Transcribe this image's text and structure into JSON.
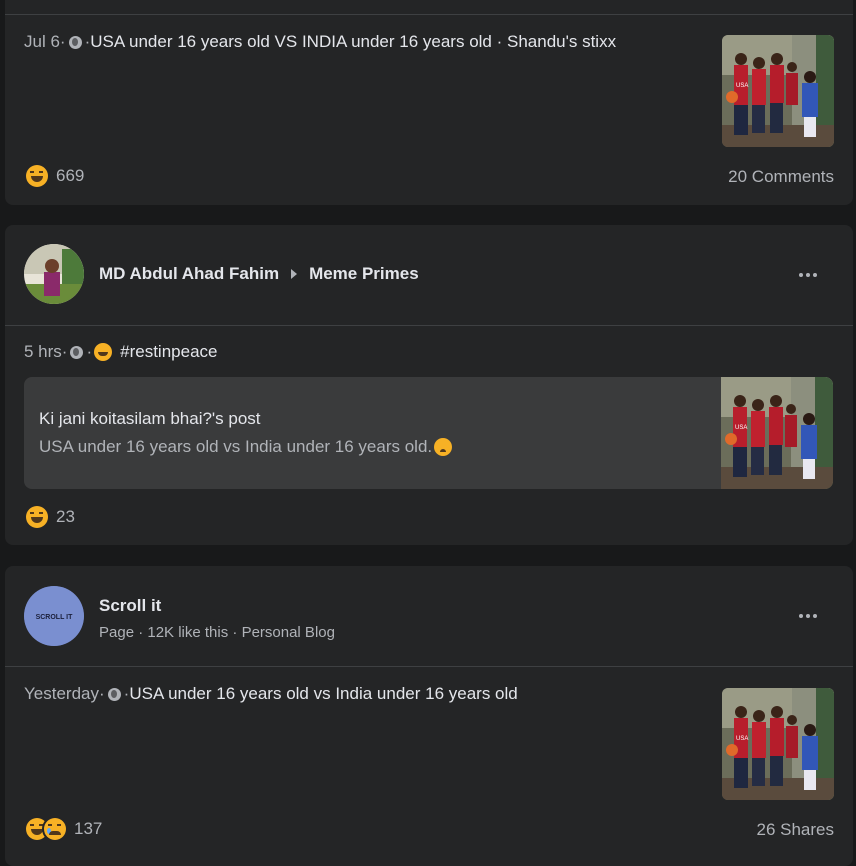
{
  "posts": [
    {
      "time": "Jul 6",
      "sep1": " · ",
      "sep2": " · ",
      "text": "USA under 16 years old VS INDIA under 16 years old · Shandu's stixx",
      "reaction_count": "669",
      "stat_right": "20 Comments"
    },
    {
      "author": "MD Abdul Ahad Fahim",
      "group": "Meme Primes",
      "time": "5 hrs",
      "sep1": " · ",
      "sep2": " · ",
      "hashtag": "#restinpeace",
      "shared_title": "Ki jani koitasilam bhai?'s post",
      "shared_text": "USA under 16 years old vs India under 16 years old.",
      "reaction_count": "23"
    },
    {
      "author": "Scroll it",
      "subtitle": "Page · 12K like this · Personal Blog",
      "avatar_text": "SCROLL IT",
      "time": "Yesterday",
      "sep1": " · ",
      "sep2": " · ",
      "text": "USA under 16 years old vs India under 16 years old",
      "reaction_count": "137",
      "stat_right": "26 Shares"
    }
  ],
  "colors": {
    "background": "#18191a",
    "card": "#242526",
    "text_primary": "#e4e6eb",
    "text_secondary": "#b0b3b8",
    "divider": "#3e4042",
    "haha": "#f7b125"
  },
  "icons": [
    "globe-icon",
    "haha-reaction-icon",
    "sad-reaction-icon",
    "more-options-icon",
    "caret-right-icon",
    "grinning-sweat-emoji",
    "pleading-emoji"
  ]
}
